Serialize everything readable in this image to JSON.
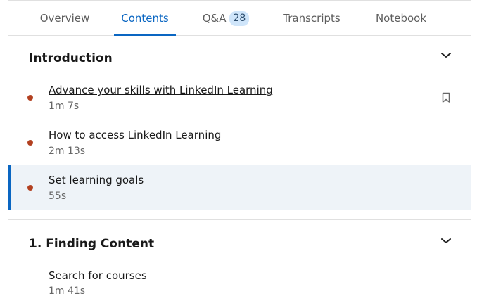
{
  "tabs": [
    {
      "label": "Overview",
      "active": false
    },
    {
      "label": "Contents",
      "active": true
    },
    {
      "label": "Q&A",
      "badge": "28",
      "active": false
    },
    {
      "label": "Transcripts",
      "active": false
    },
    {
      "label": "Notebook",
      "active": false
    }
  ],
  "sections": [
    {
      "title": "Introduction",
      "expanded": true,
      "icon": "chevron-down-icon",
      "items": [
        {
          "title": "Advance your skills with LinkedIn Learning",
          "duration": "1m 7s",
          "watched": true,
          "current": false,
          "bookmark_icon": "bookmark-icon"
        },
        {
          "title": "How to access LinkedIn Learning",
          "duration": "2m 13s",
          "watched": true,
          "current": false
        },
        {
          "title": "Set learning goals",
          "duration": "55s",
          "watched": true,
          "current": true
        }
      ]
    },
    {
      "title": "1. Finding Content",
      "expanded": true,
      "icon": "chevron-down-icon",
      "items": [
        {
          "title": "Search for courses",
          "duration": "1m 41s",
          "watched": false,
          "current": false
        }
      ]
    }
  ],
  "colors": {
    "accent": "#0a66c2",
    "watched_dot": "#b24020",
    "active_row_bg": "#eef3f8",
    "badge_bg": "#cfe5fa"
  }
}
